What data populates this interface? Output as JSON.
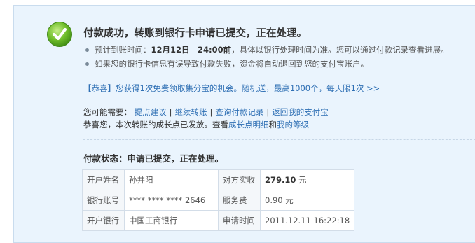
{
  "header": {
    "title": "付款成功，转账到银行卡申请已提交，正在处理。"
  },
  "tips": {
    "arrival_prefix": "预计到账时间：",
    "arrival_time": "12月12日　24:00前",
    "arrival_suffix": "，具体以银行处理时间为准。您可以通过付款记录查看进展。",
    "failure_note": "如果您的银行卡信息有误导致付款失败，资金将自动退回到您的支付宝账户。"
  },
  "promo": {
    "text": "【恭喜】您获得1次免费领取集分宝的机会。随机送，最高1000个，每天限1次 >>"
  },
  "actions": {
    "prefix": "您可能需要：",
    "suggest": "提点建议",
    "continue": "继续转账",
    "query": "查询付款记录",
    "back": "返回我的支付宝"
  },
  "growth": {
    "prefix": "恭喜您，本次转账的成长点已发放。查看",
    "detail_link": "成长点明细",
    "and": "和",
    "level_link": "我的等级"
  },
  "status": {
    "text": "付款状态：申请已提交，正在处理。"
  },
  "info_table": {
    "name_label": "开户姓名",
    "name_value": "孙井阳",
    "paid_label": "对方实收",
    "paid_amount": "279.10",
    "paid_unit": " 元",
    "account_label": "银行账号",
    "account_value": "**** **** **** 2646",
    "fee_label": "服务费",
    "fee_value": "0.90 元",
    "bank_label": "开户银行",
    "bank_value": "中国工商银行",
    "time_label": "申请时间",
    "time_value": "2011.12.11 16:22:18"
  },
  "colors": {
    "panel_bg": "#eaf4fd",
    "link": "#2e6fb4",
    "success_green": "#5aa81e"
  }
}
